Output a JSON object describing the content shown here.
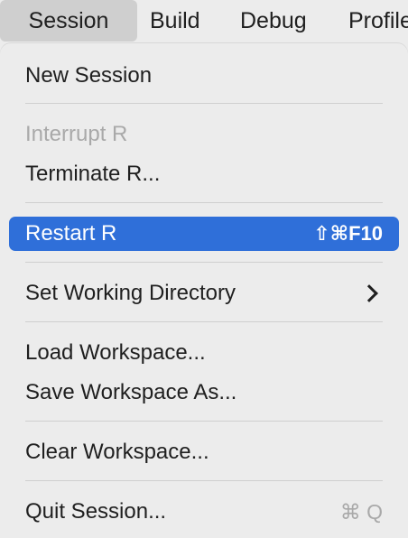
{
  "menubar": {
    "items": [
      {
        "label": "Session",
        "active": true
      },
      {
        "label": "Build"
      },
      {
        "label": "Debug"
      },
      {
        "label": "Profile"
      }
    ]
  },
  "menu": {
    "items": [
      {
        "label": "New Session"
      },
      {
        "label": "Interrupt R",
        "disabled": true
      },
      {
        "label": "Terminate R..."
      },
      {
        "label": "Restart R",
        "shortcut": "⇧⌘F10",
        "highlighted": true
      },
      {
        "label": "Set Working Directory",
        "submenu": true
      },
      {
        "label": "Load Workspace..."
      },
      {
        "label": "Save Workspace As..."
      },
      {
        "label": "Clear Workspace..."
      },
      {
        "label": "Quit Session...",
        "shortcut": "⌘ Q"
      }
    ]
  },
  "colors": {
    "menu_background": "#ececec",
    "highlight": "#2f6fd9",
    "disabled_text": "#a9a9a9"
  }
}
